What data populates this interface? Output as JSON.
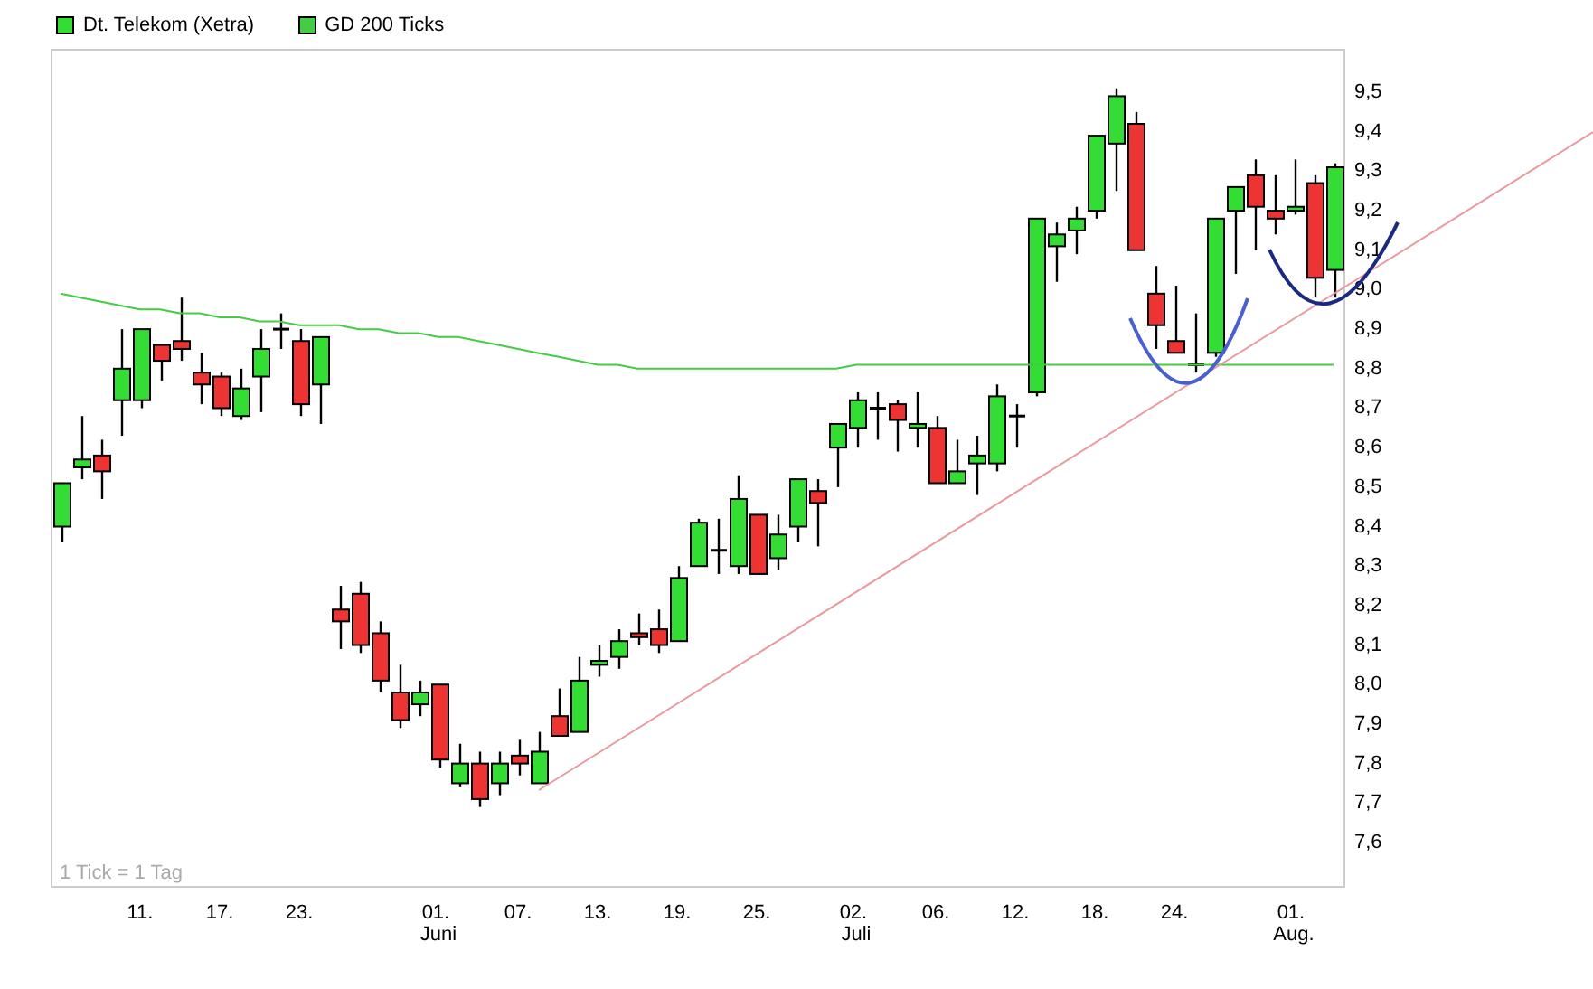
{
  "chart_data": {
    "type": "candlestick",
    "categories": [
      null,
      null,
      null,
      null,
      "11.",
      null,
      null,
      null,
      "17.",
      null,
      null,
      null,
      "23.",
      null,
      null,
      null,
      null,
      null,
      null,
      "01. Juni",
      null,
      null,
      null,
      "07.",
      null,
      null,
      null,
      "13.",
      null,
      null,
      null,
      "19.",
      null,
      null,
      null,
      "25.",
      null,
      null,
      null,
      null,
      "02. Juli",
      null,
      null,
      null,
      "06.",
      null,
      null,
      null,
      "12.",
      null,
      null,
      null,
      "18.",
      null,
      null,
      null,
      "24.",
      null,
      null,
      null,
      null,
      null,
      "01. Aug.",
      null,
      null
    ],
    "ylim": [
      7.49,
      9.61
    ],
    "yticks": [
      {
        "value": 7.6,
        "label": "7,6"
      },
      {
        "value": 7.7,
        "label": "7,7"
      },
      {
        "value": 7.8,
        "label": "7,8"
      },
      {
        "value": 7.9,
        "label": "7,9"
      },
      {
        "value": 8.0,
        "label": "8,0"
      },
      {
        "value": 8.1,
        "label": "8,1"
      },
      {
        "value": 8.2,
        "label": "8,2"
      },
      {
        "value": 8.3,
        "label": "8,3"
      },
      {
        "value": 8.4,
        "label": "8,4"
      },
      {
        "value": 8.5,
        "label": "8,5"
      },
      {
        "value": 8.6,
        "label": "8,6"
      },
      {
        "value": 8.7,
        "label": "8,7"
      },
      {
        "value": 8.8,
        "label": "8,8"
      },
      {
        "value": 8.9,
        "label": "8,9"
      },
      {
        "value": 9.0,
        "label": "9,0"
      },
      {
        "value": 9.1,
        "label": "9,1"
      },
      {
        "value": 9.2,
        "label": "9,2"
      },
      {
        "value": 9.3,
        "label": "9,3"
      },
      {
        "value": 9.4,
        "label": "9,4"
      },
      {
        "value": 9.5,
        "label": "9,5"
      }
    ],
    "series": [
      {
        "name": "Dt. Telekom (Xetra)",
        "color": "#33dd33",
        "colors": [
          "#33dd33",
          "#33dd33",
          "#ee3333",
          "#33dd33",
          "#33dd33",
          "#ee3333",
          "#ee3333",
          "#ee3333",
          "#ee3333",
          "#33dd33",
          "#33dd33",
          "#000000",
          "#ee3333",
          "#33dd33",
          "#ee3333",
          "#ee3333",
          "#ee3333",
          "#ee3333",
          "#33dd33",
          "#ee3333",
          "#33dd33",
          "#ee3333",
          "#33dd33",
          "#ee3333",
          "#33dd33",
          "#ee3333",
          "#33dd33",
          "#33dd33",
          "#33dd33",
          "#ee3333",
          "#ee3333",
          "#33dd33",
          "#33dd33",
          "#000000",
          "#33dd33",
          "#ee3333",
          "#33dd33",
          "#33dd33",
          "#ee3333",
          "#33dd33",
          "#33dd33",
          "#000000",
          "#ee3333",
          "#33dd33",
          "#ee3333",
          "#33dd33",
          "#33dd33",
          "#33dd33",
          "#000000",
          "#33dd33",
          "#33dd33",
          "#33dd33",
          "#33dd33",
          "#33dd33",
          "#ee3333",
          "#ee3333",
          "#ee3333",
          "#000000",
          "#33dd33",
          "#33dd33",
          "#ee3333",
          "#ee3333",
          "#33dd33",
          "#ee3333",
          "#33dd33"
        ],
        "ohlc": [
          [
            8.4,
            8.51,
            8.36,
            8.51
          ],
          [
            8.55,
            8.68,
            8.52,
            8.57
          ],
          [
            8.58,
            8.62,
            8.47,
            8.54
          ],
          [
            8.72,
            8.9,
            8.63,
            8.8
          ],
          [
            8.72,
            8.9,
            8.7,
            8.9
          ],
          [
            8.86,
            8.86,
            8.77,
            8.82
          ],
          [
            8.87,
            8.98,
            8.82,
            8.85
          ],
          [
            8.79,
            8.84,
            8.71,
            8.76
          ],
          [
            8.78,
            8.79,
            8.68,
            8.7
          ],
          [
            8.68,
            8.8,
            8.67,
            8.75
          ],
          [
            8.78,
            8.9,
            8.69,
            8.85
          ],
          [
            8.9,
            8.94,
            8.85,
            8.9
          ],
          [
            8.87,
            8.9,
            8.68,
            8.71
          ],
          [
            8.76,
            8.88,
            8.66,
            8.88
          ],
          [
            8.19,
            8.25,
            8.09,
            8.16
          ],
          [
            8.23,
            8.26,
            8.08,
            8.1
          ],
          [
            8.13,
            8.16,
            7.98,
            8.01
          ],
          [
            7.98,
            8.05,
            7.89,
            7.91
          ],
          [
            7.95,
            8.01,
            7.92,
            7.98
          ],
          [
            8.0,
            8.0,
            7.79,
            7.81
          ],
          [
            7.75,
            7.85,
            7.74,
            7.8
          ],
          [
            7.8,
            7.83,
            7.69,
            7.71
          ],
          [
            7.75,
            7.83,
            7.72,
            7.8
          ],
          [
            7.82,
            7.86,
            7.77,
            7.8
          ],
          [
            7.75,
            7.88,
            7.75,
            7.83
          ],
          [
            7.92,
            7.99,
            7.87,
            7.87
          ],
          [
            7.88,
            8.07,
            7.88,
            8.01
          ],
          [
            8.05,
            8.1,
            8.02,
            8.06
          ],
          [
            8.07,
            8.14,
            8.04,
            8.11
          ],
          [
            8.13,
            8.18,
            8.1,
            8.12
          ],
          [
            8.14,
            8.19,
            8.08,
            8.1
          ],
          [
            8.11,
            8.3,
            8.11,
            8.27
          ],
          [
            8.3,
            8.42,
            8.3,
            8.41
          ],
          [
            8.34,
            8.42,
            8.28,
            8.34
          ],
          [
            8.3,
            8.53,
            8.28,
            8.47
          ],
          [
            8.43,
            8.43,
            8.28,
            8.28
          ],
          [
            8.32,
            8.43,
            8.29,
            8.38
          ],
          [
            8.4,
            8.52,
            8.36,
            8.52
          ],
          [
            8.49,
            8.52,
            8.35,
            8.46
          ],
          [
            8.6,
            8.66,
            8.5,
            8.66
          ],
          [
            8.65,
            8.74,
            8.6,
            8.72
          ],
          [
            8.7,
            8.74,
            8.62,
            8.7
          ],
          [
            8.71,
            8.72,
            8.59,
            8.67
          ],
          [
            8.65,
            8.74,
            8.6,
            8.66
          ],
          [
            8.65,
            8.68,
            8.51,
            8.51
          ],
          [
            8.51,
            8.62,
            8.51,
            8.54
          ],
          [
            8.56,
            8.63,
            8.48,
            8.58
          ],
          [
            8.56,
            8.76,
            8.54,
            8.73
          ],
          [
            8.68,
            8.71,
            8.6,
            8.68
          ],
          [
            8.74,
            9.18,
            8.73,
            9.18
          ],
          [
            9.11,
            9.17,
            9.02,
            9.14
          ],
          [
            9.15,
            9.21,
            9.09,
            9.18
          ],
          [
            9.2,
            9.39,
            9.18,
            9.39
          ],
          [
            9.37,
            9.51,
            9.25,
            9.49
          ],
          [
            9.42,
            9.45,
            9.1,
            9.1
          ],
          [
            8.99,
            9.06,
            8.85,
            8.91
          ],
          [
            8.87,
            9.01,
            8.84,
            8.84
          ],
          [
            8.81,
            8.94,
            8.79,
            8.81
          ],
          [
            8.84,
            9.18,
            8.83,
            9.18
          ],
          [
            9.2,
            9.26,
            9.04,
            9.26
          ],
          [
            9.29,
            9.33,
            9.1,
            9.21
          ],
          [
            9.2,
            9.29,
            9.14,
            9.18
          ],
          [
            9.2,
            9.33,
            9.19,
            9.21
          ],
          [
            9.27,
            9.29,
            8.98,
            9.03
          ],
          [
            9.05,
            9.32,
            8.98,
            9.31
          ]
        ]
      },
      {
        "name": "GD 200 Ticks",
        "type": "line",
        "color": "#44cc44",
        "values": [
          8.99,
          8.98,
          8.97,
          8.96,
          8.95,
          8.95,
          8.94,
          8.94,
          8.93,
          8.93,
          8.92,
          8.92,
          8.91,
          8.91,
          8.91,
          8.9,
          8.9,
          8.89,
          8.89,
          8.88,
          8.88,
          8.87,
          8.86,
          8.85,
          8.84,
          8.83,
          8.82,
          8.81,
          8.81,
          8.8,
          8.8,
          8.8,
          8.8,
          8.8,
          8.8,
          8.8,
          8.8,
          8.8,
          8.8,
          8.8,
          8.81,
          8.81,
          8.81,
          8.81,
          8.81,
          8.81,
          8.81,
          8.81,
          8.81,
          8.81,
          8.81,
          8.81,
          8.81,
          8.81,
          8.81,
          8.81,
          8.81,
          8.81,
          8.81,
          8.81,
          8.81,
          8.81,
          8.81,
          8.81,
          8.81
        ]
      }
    ]
  },
  "chart_note": "1 Tick = 1 Tag"
}
